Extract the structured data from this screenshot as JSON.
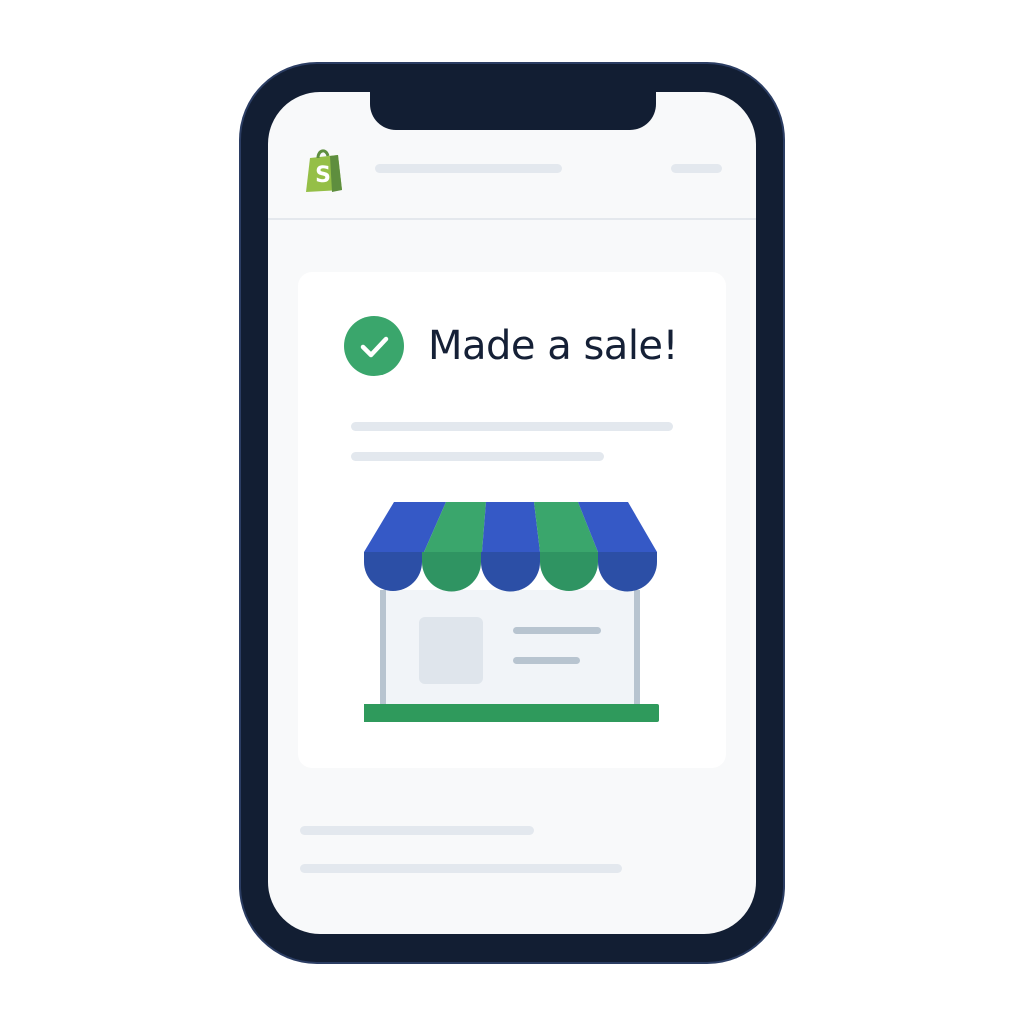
{
  "app": {
    "logo_icon": "shopify-bag-icon",
    "brand_color": "#5e9a3c"
  },
  "notification": {
    "title": "Made a sale!",
    "status_icon": "check-circle-icon",
    "status_color": "#3aa66c"
  },
  "illustration": {
    "name": "storefront-awning-icon",
    "awning_colors": [
      "#3559c6",
      "#3aa66c"
    ],
    "base_color": "#2f9a5c"
  }
}
